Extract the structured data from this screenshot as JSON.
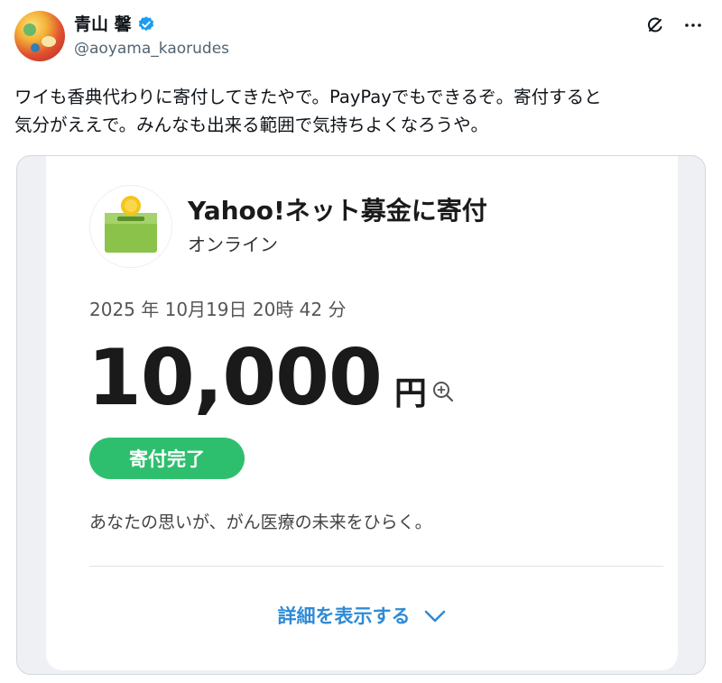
{
  "user": {
    "display_name": "青山 馨",
    "handle": "@aoyama_kaorudes"
  },
  "tweet": {
    "text": "ワイも香典代わりに寄付してきたやで。PayPayでもできるぞ。寄付すると\n気分がええで。みんなも出来る範囲で気持ちよくなろうや。"
  },
  "card": {
    "title": "Yahoo!ネット募金に寄付",
    "subtitle": "オンライン",
    "datetime": "2025 年 10月19日 20時 42 分",
    "amount": "10,000",
    "currency": "円",
    "status": "寄付完了",
    "message": "あなたの思いが、がん医療の未来をひらく。",
    "details_label": "詳細を表示する"
  },
  "colors": {
    "verified": "#1d9bf0",
    "status_green": "#2ebf6e",
    "link_blue": "#2f8bd6",
    "logo_green": "#8bc34a",
    "coin_gold": "#f5c518"
  },
  "icons": [
    "verified-badge-icon",
    "grok-icon",
    "more-icon",
    "zoom-in-icon",
    "chevron-down-icon",
    "donation-box-icon"
  ]
}
